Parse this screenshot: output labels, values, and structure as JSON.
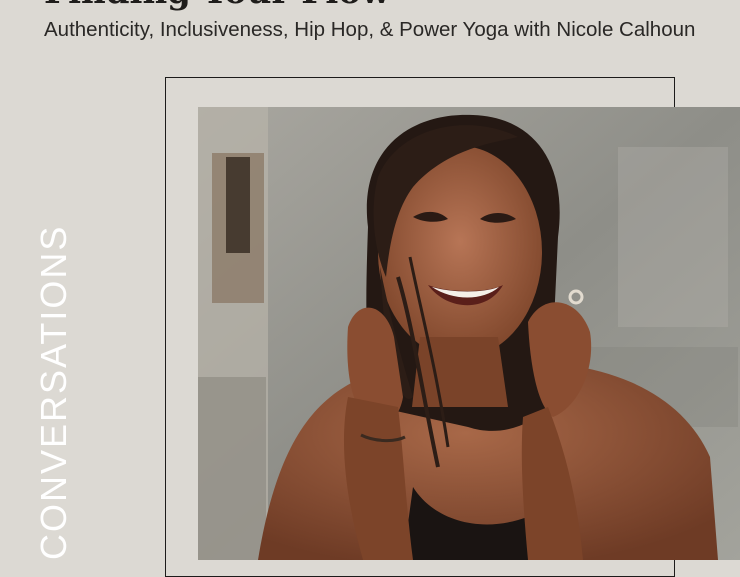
{
  "header": {
    "title": "Finding Your Flow",
    "subtitle": "Authenticity, Inclusiveness, Hip Hop, & Power Yoga with Nicole Calhoun"
  },
  "side": {
    "label": "CONVERSATIONS"
  },
  "colors": {
    "background": "#dcd9d3",
    "text": "#1f1d1b",
    "frame": "#1c1b1a",
    "side_label": "#ffffff"
  }
}
